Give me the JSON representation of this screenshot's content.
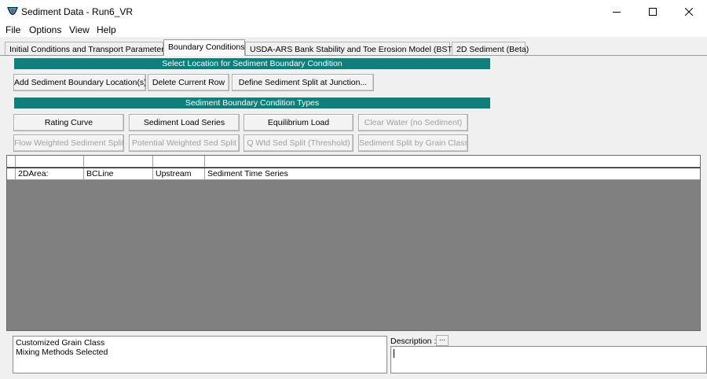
{
  "window": {
    "title": "Sediment Data - Run6_VR",
    "controls": {
      "minimize": "minimize-icon",
      "maximize": "maximize-icon",
      "close": "close-icon"
    }
  },
  "menu": [
    "File",
    "Options",
    "View",
    "Help"
  ],
  "tabs": [
    {
      "label": "Initial Conditions and Transport Parameters",
      "active": false
    },
    {
      "label": "Boundary Conditions",
      "active": true
    },
    {
      "label": "USDA-ARS Bank Stability and Toe Erosion Model (BSTEM)",
      "active": false
    },
    {
      "label": "2D Sediment (Beta)",
      "active": false
    }
  ],
  "location_section": {
    "header": "Select Location for Sediment Boundary Condition",
    "buttons": [
      "Add Sediment Boundary Location(s)",
      "Delete Current Row",
      "Define Sediment Split at Junction..."
    ]
  },
  "types_section": {
    "header": "Sediment Boundary Condition Types",
    "row1": [
      {
        "label": "Rating Curve",
        "enabled": true
      },
      {
        "label": "Sediment Load Series",
        "enabled": true
      },
      {
        "label": "Equilibrium Load",
        "enabled": true
      },
      {
        "label": "Clear Water (no Sediment)",
        "enabled": false
      }
    ],
    "row2": [
      {
        "label": "Flow Weighted Sediment Split",
        "enabled": false
      },
      {
        "label": "Potential Weighted Sed Split",
        "enabled": false
      },
      {
        "label": "Q Wtd Sed Split (Threshold)",
        "enabled": false
      },
      {
        "label": "Sediment Split by Grain Class",
        "enabled": false
      }
    ]
  },
  "grid": {
    "headers": [
      "",
      "",
      "",
      "",
      ""
    ],
    "rows": [
      [
        "",
        "2DArea:",
        "BCLine",
        "Upstream",
        "Sediment Time Series"
      ]
    ]
  },
  "info_lines": [
    "Customized Grain Class",
    "Mixing Methods Selected"
  ],
  "description": {
    "label": "Description :",
    "button": "...",
    "value": ""
  },
  "colors": {
    "band": "#0e7f7b",
    "grid_background": "#808080"
  }
}
